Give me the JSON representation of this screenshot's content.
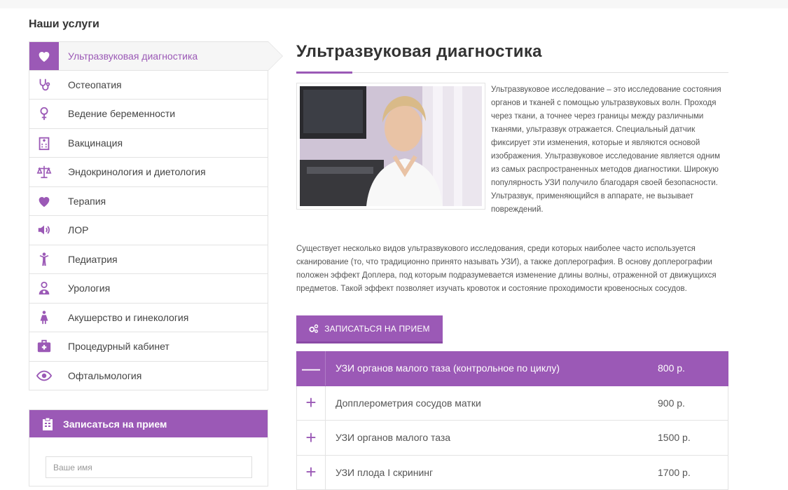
{
  "sidebar": {
    "heading": "Наши услуги",
    "items": [
      {
        "label": "Ультразвуковая диагностика",
        "icon": "heart-icon",
        "active": true
      },
      {
        "label": "Остеопатия",
        "icon": "stethoscope-icon"
      },
      {
        "label": "Ведение беременности",
        "icon": "female-icon"
      },
      {
        "label": "Вакцинация",
        "icon": "hospital-icon"
      },
      {
        "label": "Эндокринология и диетология",
        "icon": "scales-icon"
      },
      {
        "label": "Терапия",
        "icon": "heart-icon"
      },
      {
        "label": "ЛОР",
        "icon": "volume-icon"
      },
      {
        "label": "Педиатрия",
        "icon": "child-icon"
      },
      {
        "label": "Урология",
        "icon": "doctor-icon"
      },
      {
        "label": "Акушерство и гинекология",
        "icon": "woman-icon"
      },
      {
        "label": "Процедурный кабинет",
        "icon": "medkit-icon"
      },
      {
        "label": "Офтальмология",
        "icon": "eye-icon"
      }
    ]
  },
  "booking": {
    "title": "Записаться на прием",
    "name_placeholder": "Ваше имя"
  },
  "main": {
    "title": "Ультразвуковая диагностика",
    "intro": "Ультразвуковое исследование – это исследование состояния органов и тканей с помощью ультразвуковых волн. Проходя через ткани, а точнее через границы между различными тканями, ультразвук отражается. Специальный датчик фиксирует эти изменения, которые и являются основой изображения. Ультразвуковое исследование является одним из самых распространенных методов диагностики. Широкую популярность УЗИ получило благодаря своей безопасности. Ультразвук, применяющийся в аппарате, не вызывает повреждений.",
    "body": "Существует несколько видов ультразвукового исследования, среди которых наиболее часто используется сканирование (то, что традиционно принято называть УЗИ), а также доплерография. В основу доплерографии положен эффект Доплера, под которым подразумевается изменение длины волны, отраженной от движущихся предметов. Такой эффект позволяет изучать кровоток и состояние проходимости кровеносных сосудов.",
    "cta_label": "ЗАПИСАТЬСЯ НА ПРИЕМ"
  },
  "prices": [
    {
      "toggle": "—",
      "name": "УЗИ органов малого таза (контрольное по циклу)",
      "price": "800 р.",
      "open": true
    },
    {
      "toggle": "+",
      "name": "Допплерометрия сосудов матки",
      "price": "900 р."
    },
    {
      "toggle": "+",
      "name": "УЗИ органов малого таза",
      "price": "1500 р."
    },
    {
      "toggle": "+",
      "name": "УЗИ плода I скрининг",
      "price": "1700 р."
    }
  ],
  "colors": {
    "accent": "#9b59b6"
  }
}
